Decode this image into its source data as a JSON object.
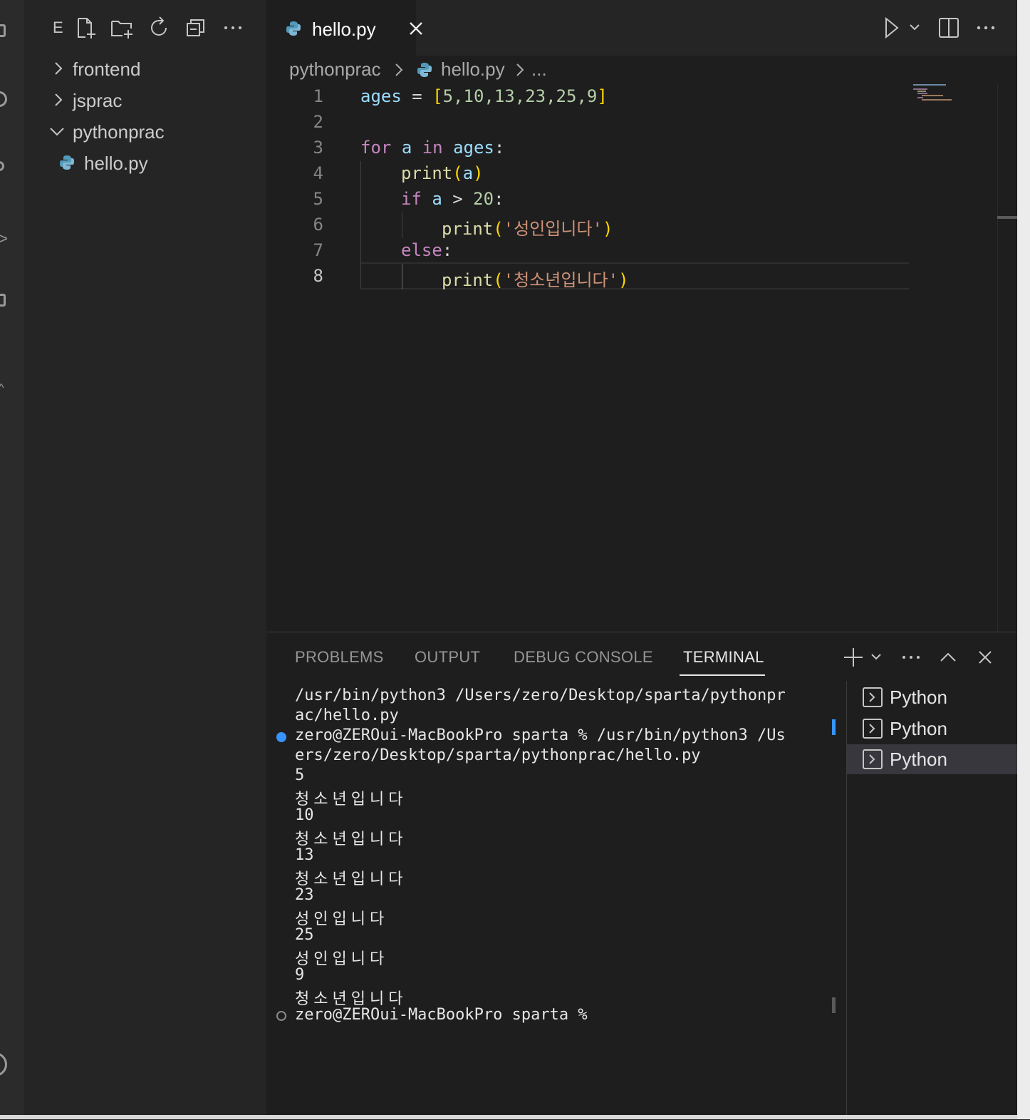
{
  "explorer": {
    "header_letter": "E",
    "toolbar_icons": [
      "new-file-icon",
      "new-folder-icon",
      "refresh-icon",
      "collapse-all-icon",
      "more-icon"
    ],
    "tree": [
      {
        "label": "frontend",
        "expanded": false
      },
      {
        "label": "jsprac",
        "expanded": false
      },
      {
        "label": "pythonprac",
        "expanded": true
      },
      {
        "label": "hello.py",
        "file": true
      }
    ]
  },
  "editor": {
    "tab": {
      "label": "hello.py"
    },
    "breadcrumb": [
      "pythonprac",
      "hello.py",
      "..."
    ],
    "line_numbers": [
      "1",
      "2",
      "3",
      "4",
      "5",
      "6",
      "7",
      "8"
    ],
    "active_line": "8",
    "code_tokens": {
      "l1": {
        "var": "ages",
        "op": " = ",
        "open": "[",
        "nums": "5,10,13,23,25,9",
        "close": "]"
      },
      "l3": {
        "kw1": "for",
        "var1": "a",
        "kw2": "in",
        "var2": "ages",
        "colon": ":"
      },
      "l4": {
        "fn": "print",
        "open": "(",
        "var": "a",
        "close": ")"
      },
      "l5": {
        "kw": "if",
        "var": "a",
        "op": " > ",
        "num": "20",
        "colon": ":"
      },
      "l6": {
        "fn": "print",
        "open": "(",
        "str": "'성인입니다'",
        "close": ")"
      },
      "l7": {
        "kw": "else",
        "colon": ":"
      },
      "l8": {
        "fn": "print",
        "open": "(",
        "str": "'청소년입니다'",
        "close": ")"
      }
    }
  },
  "panel": {
    "tabs": [
      "PROBLEMS",
      "OUTPUT",
      "DEBUG CONSOLE",
      "TERMINAL"
    ],
    "active_tab": "TERMINAL",
    "terminal_lines": [
      "/usr/bin/python3 /Users/zero/Desktop/sparta/pythonpr",
      "ac/hello.py",
      "zero@ZEROui-MacBookPro sparta % /usr/bin/python3 /Us",
      "ers/zero/Desktop/sparta/pythonprac/hello.py",
      "5",
      "청소년입니다",
      "10",
      "청소년입니다",
      "13",
      "청소년입니다",
      "23",
      "성인입니다",
      "25",
      "성인입니다",
      "9",
      "청소년입니다",
      "zero@ZEROui-MacBookPro sparta %"
    ],
    "terminal_instances": [
      "Python",
      "Python",
      "Python"
    ],
    "selected_instance": 2
  },
  "colors": {
    "keyword": "#c586c0",
    "variable": "#9cdcfe",
    "function": "#dcdcaa",
    "number": "#b5cea8",
    "string": "#ce9178",
    "bracket1": "#ffd700",
    "bracket2": "#da70d6",
    "accent": "#3794ff"
  }
}
